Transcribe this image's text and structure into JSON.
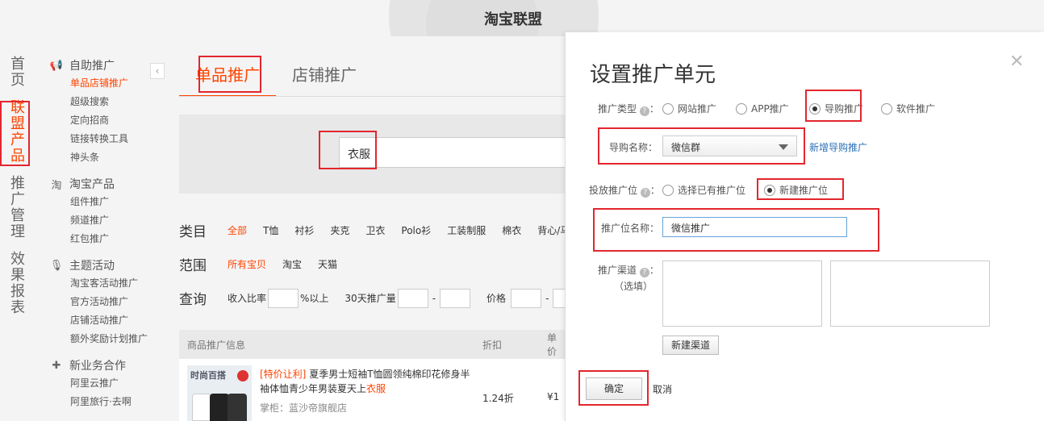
{
  "header": {
    "site_title": "淘宝联盟"
  },
  "main_nav": [
    {
      "label": "首页",
      "chars": [
        "首",
        "页"
      ],
      "active": false
    },
    {
      "label": "联盟产品",
      "chars": [
        "联",
        "盟",
        "产",
        "品"
      ],
      "active": true
    },
    {
      "label": "推广管理",
      "chars": [
        "推",
        "广",
        "管",
        "理"
      ],
      "active": false
    },
    {
      "label": "效果报表",
      "chars": [
        "效",
        "果",
        "报",
        "表"
      ],
      "active": false
    }
  ],
  "sidebar": {
    "collapse_icon": "chevron-left-icon",
    "collapse_glyph": "‹",
    "sections": [
      {
        "title": "自助推广",
        "icon": "megaphone-icon",
        "glyph": "📢",
        "items": [
          {
            "label": "单品店铺推广",
            "active": true
          },
          {
            "label": "超级搜索"
          },
          {
            "label": "定向招商"
          },
          {
            "label": "链接转换工具"
          },
          {
            "label": "神头条"
          }
        ]
      },
      {
        "title": "淘宝产品",
        "icon": "taobao-icon",
        "glyph": "淘",
        "items": [
          {
            "label": "组件推广"
          },
          {
            "label": "频道推广"
          },
          {
            "label": "红包推广"
          }
        ]
      },
      {
        "title": "主题活动",
        "icon": "microphone-icon",
        "glyph": "🎙",
        "items": [
          {
            "label": "淘宝客活动推广"
          },
          {
            "label": "官方活动推广"
          },
          {
            "label": "店铺活动推广"
          },
          {
            "label": "额外奖励计划推广"
          }
        ]
      },
      {
        "title": "新业务合作",
        "icon": "puzzle-icon",
        "glyph": "✚",
        "items": [
          {
            "label": "阿里云推广"
          },
          {
            "label": "阿里旅行·去啊"
          }
        ]
      }
    ]
  },
  "main": {
    "tabs": [
      {
        "label": "单品推广",
        "active": true
      },
      {
        "label": "店铺推广",
        "active": false
      }
    ],
    "search": {
      "value": "衣服"
    },
    "category": {
      "label": "类目",
      "options": [
        "全部",
        "T恤",
        "衬衫",
        "夹克",
        "卫衣",
        "Polo衫",
        "工装制服",
        "棉衣",
        "背心/马甲"
      ]
    },
    "scope": {
      "label": "范围",
      "options": [
        "所有宝贝",
        "淘宝",
        "天猫"
      ]
    },
    "query": {
      "label": "查询",
      "income_ratio": "收入比率",
      "percent_above": "%以上",
      "sales_30d": "30天推广量",
      "dash": "-",
      "price": "价格"
    },
    "result": {
      "headers": [
        "商品推广信息",
        "折扣",
        "单价"
      ],
      "product": {
        "image_brand": "时尚百搭",
        "promo_tag": "[特价让利]",
        "title_main": "夏季男士短袖T恤圆领纯棉印花修身半袖体恤青少年男装夏天上",
        "title_highlight": "衣服",
        "shop": "掌柜：蓝沙帝旗舰店",
        "discount": "1.24折",
        "price": "¥1"
      }
    }
  },
  "modal": {
    "title": "设置推广单元",
    "close_glyph": "✕",
    "help_glyph": "?",
    "promo_type": {
      "label": "推广类型",
      "colon": "：",
      "options": [
        {
          "label": "网站推广",
          "checked": false
        },
        {
          "label": "APP推广",
          "checked": false
        },
        {
          "label": "导购推广",
          "checked": true
        },
        {
          "label": "软件推广",
          "checked": false
        }
      ]
    },
    "guide_name": {
      "label": "导购名称：",
      "selected": "微信群",
      "add_link": "新增导购推广"
    },
    "placement": {
      "label": "投放推广位",
      "colon": "：",
      "options": [
        {
          "label": "选择已有推广位",
          "checked": false
        },
        {
          "label": "新建推广位",
          "checked": true
        }
      ]
    },
    "placement_name": {
      "label": "推广位名称：",
      "value": "微信推广"
    },
    "channel": {
      "label": "推广渠道",
      "colon": "：",
      "optional": "（选填）",
      "new_button": "新建渠道"
    },
    "confirm_button": "确定",
    "cancel_button": "取消"
  }
}
